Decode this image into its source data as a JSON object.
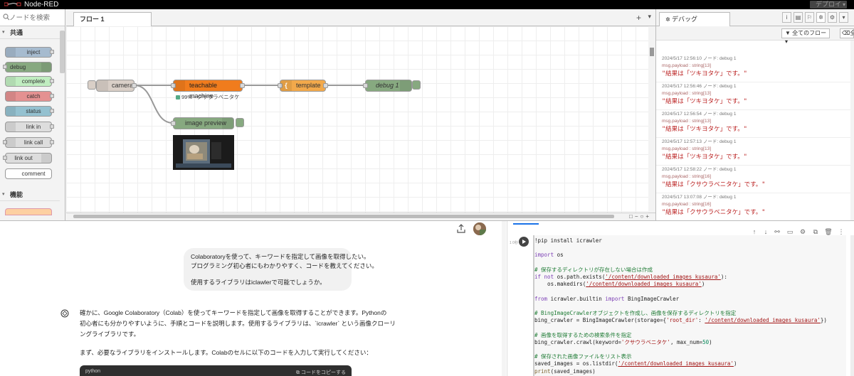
{
  "nodered": {
    "app_title": "Node-RED",
    "deploy_label": "デプロイ",
    "palette": {
      "search_placeholder": "ノードを検索",
      "categories": [
        {
          "label": "共通"
        },
        {
          "label": "機能"
        }
      ],
      "nodes": [
        {
          "label": "inject",
          "color": "#a6bbcf"
        },
        {
          "label": "debug",
          "color": "#87a980"
        },
        {
          "label": "complete",
          "color": "#c0edc0"
        },
        {
          "label": "catch",
          "color": "#e49191"
        },
        {
          "label": "status",
          "color": "#94c1d0"
        },
        {
          "label": "link in",
          "color": "#dddddd"
        },
        {
          "label": "link call",
          "color": "#dddddd"
        },
        {
          "label": "link out",
          "color": "#dddddd"
        },
        {
          "label": "comment",
          "color": "#ffffff"
        }
      ]
    },
    "workspace": {
      "tab_label": "フロー 1",
      "nodes": {
        "camera": {
          "label": "camera",
          "color": "#d9cfc7"
        },
        "teachable": {
          "label": "teachable machine",
          "color": "#f07c1d",
          "status": "99% - クサウラベニタケ"
        },
        "template": {
          "label": "template",
          "color": "#f2a94b"
        },
        "debug1": {
          "label": "debug 1",
          "color": "#87a980"
        },
        "preview": {
          "label": "image preview",
          "color": "#87a980"
        }
      }
    },
    "sidebar": {
      "tab_label": "デバッグ",
      "filter_label": "全てのフロー",
      "clear_label": "全て",
      "messages": [
        {
          "meta": "2024/5/17 12:56:10   ノード: debug 1",
          "topic": "msg.payload : string[13]",
          "value": "\"結果は「ツキヨタケ」です。\""
        },
        {
          "meta": "2024/5/17 12:56:46   ノード: debug 1",
          "topic": "msg.payload : string[13]",
          "value": "\"結果は「ツキヨタケ」です。\""
        },
        {
          "meta": "2024/5/17 12:56:54   ノード: debug 1",
          "topic": "msg.payload : string[13]",
          "value": "\"結果は「ツキヨタケ」です。\""
        },
        {
          "meta": "2024/5/17 12:57:13   ノード: debug 1",
          "topic": "msg.payload : string[13]",
          "value": "\"結果は「ツキヨタケ」です。\""
        },
        {
          "meta": "2024/5/17 12:58:22   ノード: debug 1",
          "topic": "msg.payload : string[16]",
          "value": "\"結果は「クサウラベニタケ」です。\""
        },
        {
          "meta": "2024/5/17 13:07:08   ノード: debug 1",
          "topic": "msg.payload : string[16]",
          "value": "\"結果は「クサウラベニタケ」です。\""
        }
      ]
    }
  },
  "chat": {
    "user_message": {
      "line1": "Colaboratoryを使って、キーワードを指定して画像を取得したい。",
      "line2": "プログラミング初心者にもわかりやすく、コードを教えてください。",
      "line3": "使用するライブラリはiclawlerで可能でしょうか。"
    },
    "assistant": {
      "p1_line1": "確かに、Google Colaboratory（Colab）を使ってキーワードを指定して画像を取得することができます。Pythonの",
      "p1_line2": "初心者にも分かりやすいように、手順とコードを説明します。使用するライブラリは、`icrawler` という画像クローリ",
      "p1_line3": "ングライブラリです。",
      "p2": "まず、必要なライブラリをインストールします。Colabのセルに以下のコードを入力して実行してください："
    },
    "code_block": {
      "language": "python",
      "copy_label": "コードをコピーする"
    }
  },
  "colab": {
    "exec_count": "1\n0秒",
    "code": [
      "!pip install icrawler",
      "",
      "import os",
      "",
      "# 保存するディレクトリが存在しない場合は作成",
      "if not os.path.exists('/content/downloaded_images_kusaura'):",
      "    os.makedirs('/content/downloaded_images_kusaura')",
      "",
      "from icrawler.builtin import BingImageCrawler",
      "",
      "# BingImageCrawlerオブジェクトを作成し、画像を保存するディレクトリを指定",
      "bing_crawler = BingImageCrawler(storage={'root_dir': '/content/downloaded_images_kusaura'})",
      "",
      "# 画像を取得するための検索条件を指定",
      "bing_crawler.crawl(keyword='クサウラベニタケ', max_num=50)",
      "",
      "# 保存された画像ファイルをリスト表示",
      "saved_images = os.listdir('/content/downloaded_images_kusaura')",
      "print(saved_images)"
    ]
  }
}
